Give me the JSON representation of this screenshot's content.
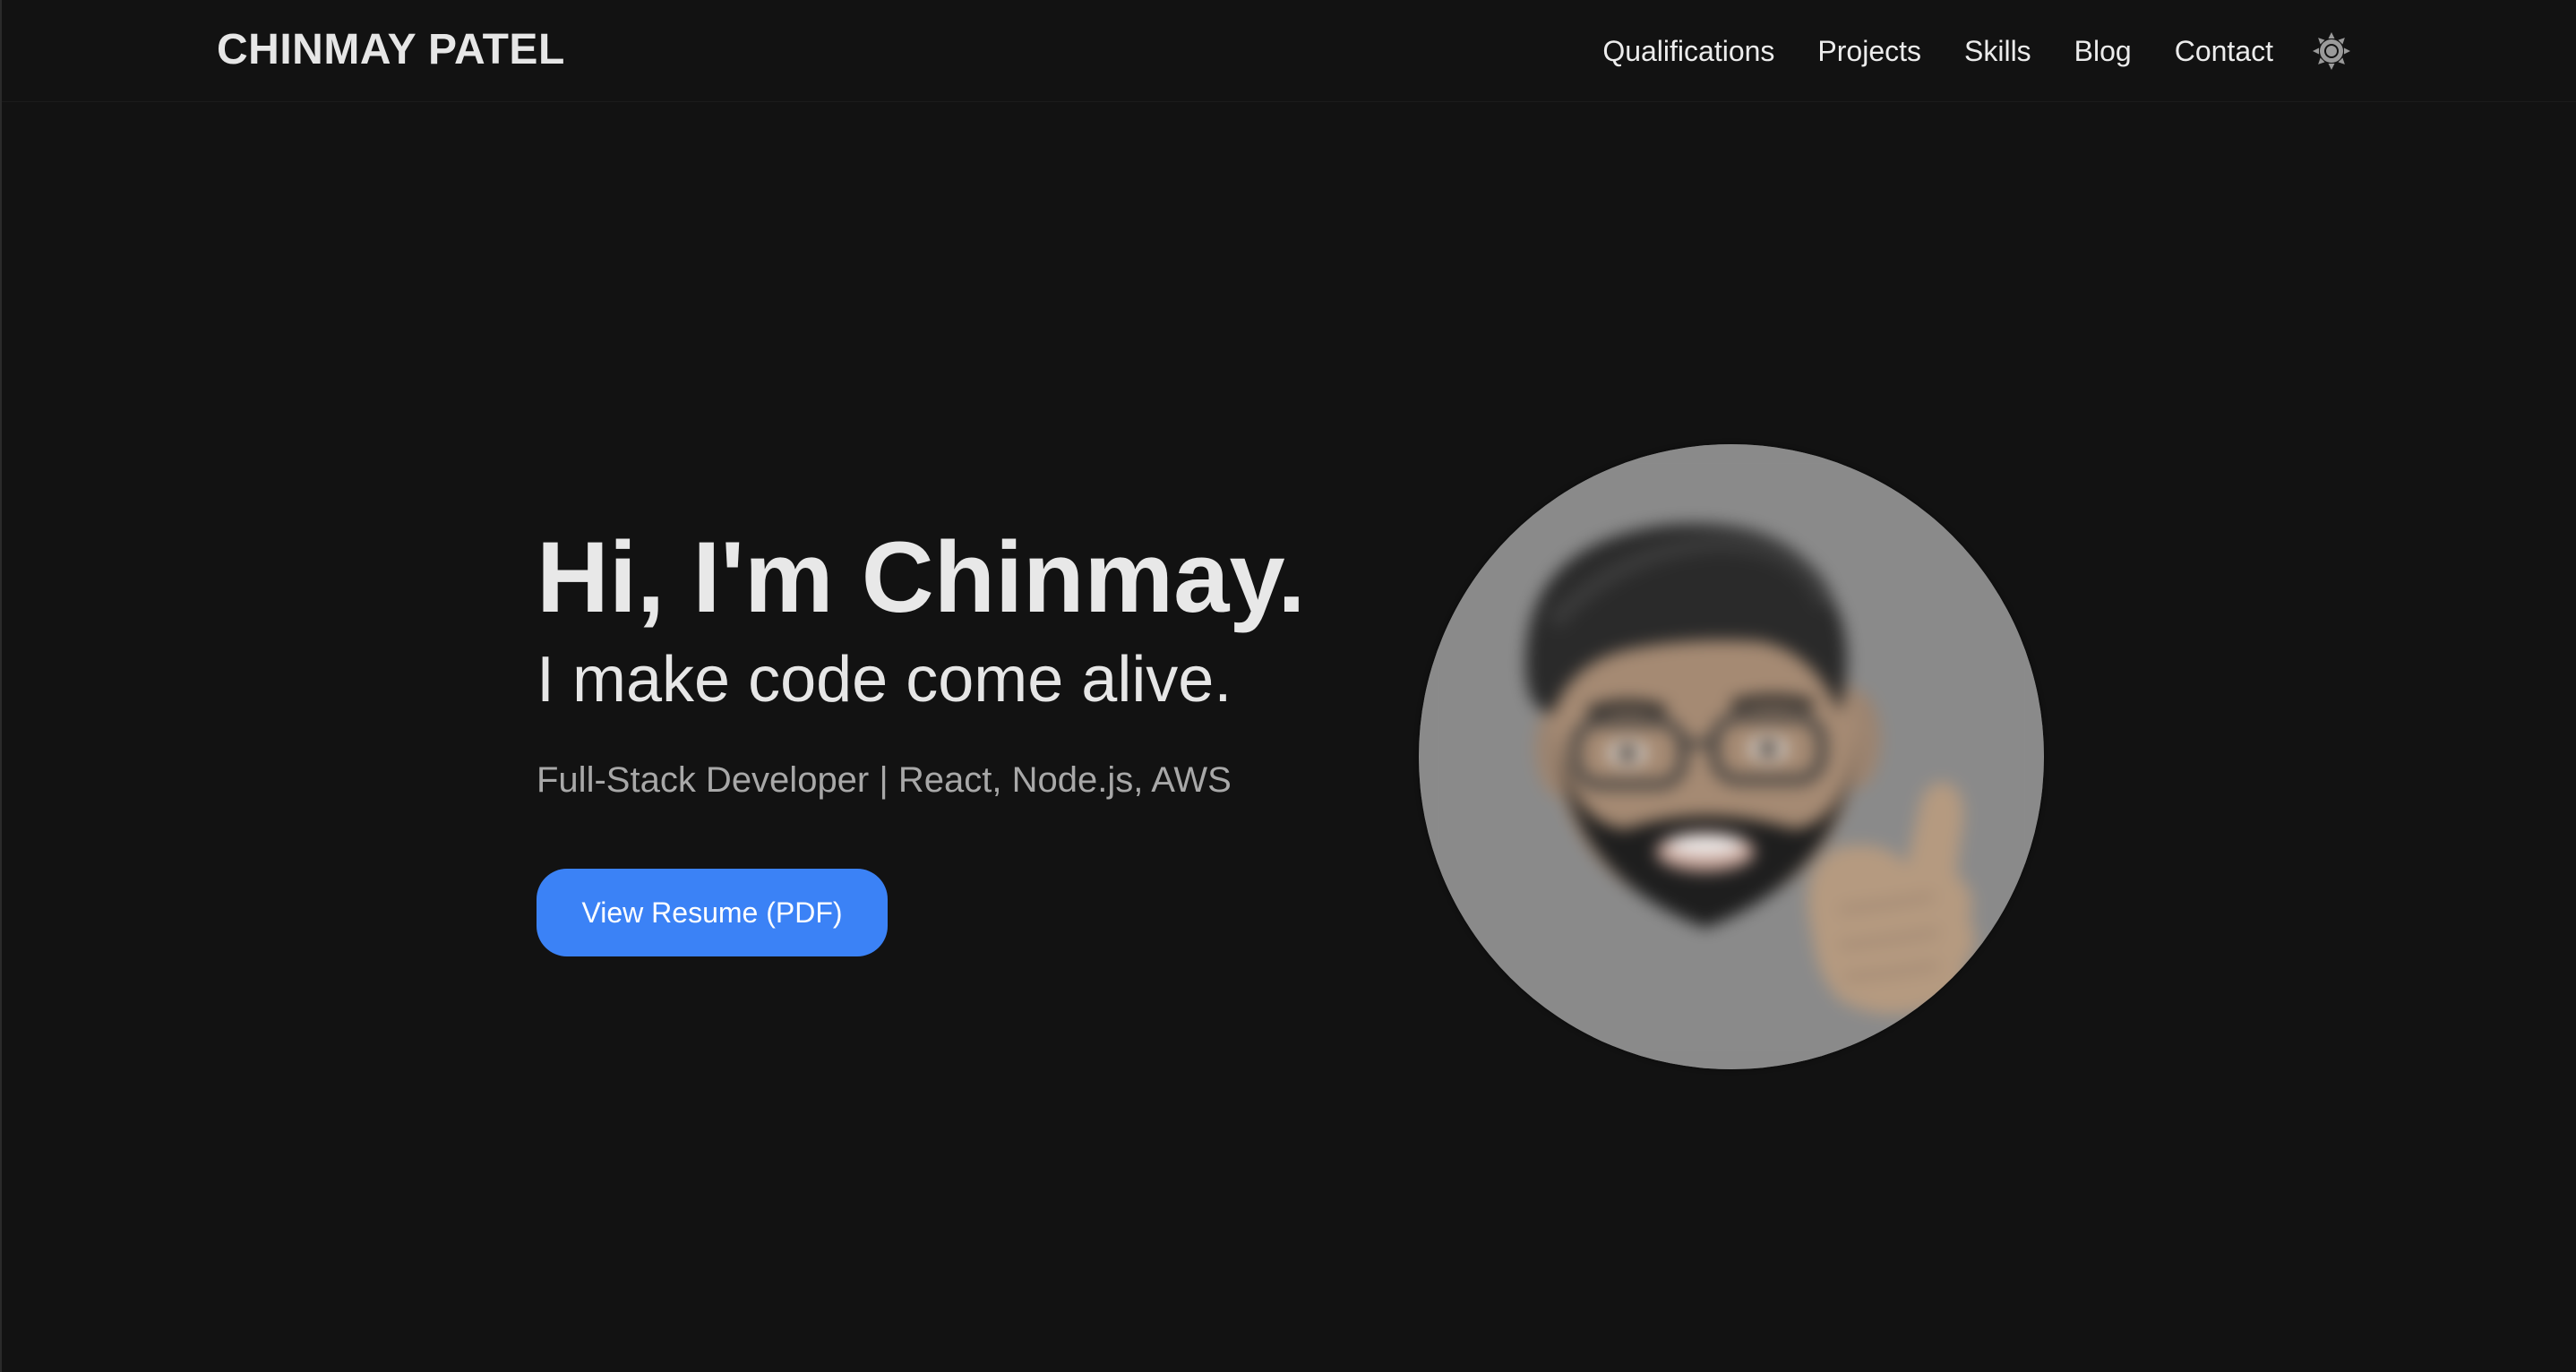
{
  "header": {
    "brand": "CHINMAY PATEL",
    "nav": [
      {
        "label": "Qualifications"
      },
      {
        "label": "Projects"
      },
      {
        "label": "Skills"
      },
      {
        "label": "Blog"
      },
      {
        "label": "Contact"
      }
    ],
    "theme_icon": "sun-icon"
  },
  "hero": {
    "title": "Hi, I'm Chinmay.",
    "subtitle": "I make code come alive.",
    "tagline": "Full-Stack Developer | React, Node.js, AWS",
    "button_label": "View Resume (PDF)",
    "avatar_icon": "memoji-avatar"
  },
  "colors": {
    "background": "#121212",
    "text": "#e8e8e8",
    "muted": "#a8a8a8",
    "accent": "#3b82f6",
    "avatar_bg": "#8a8a8a"
  }
}
